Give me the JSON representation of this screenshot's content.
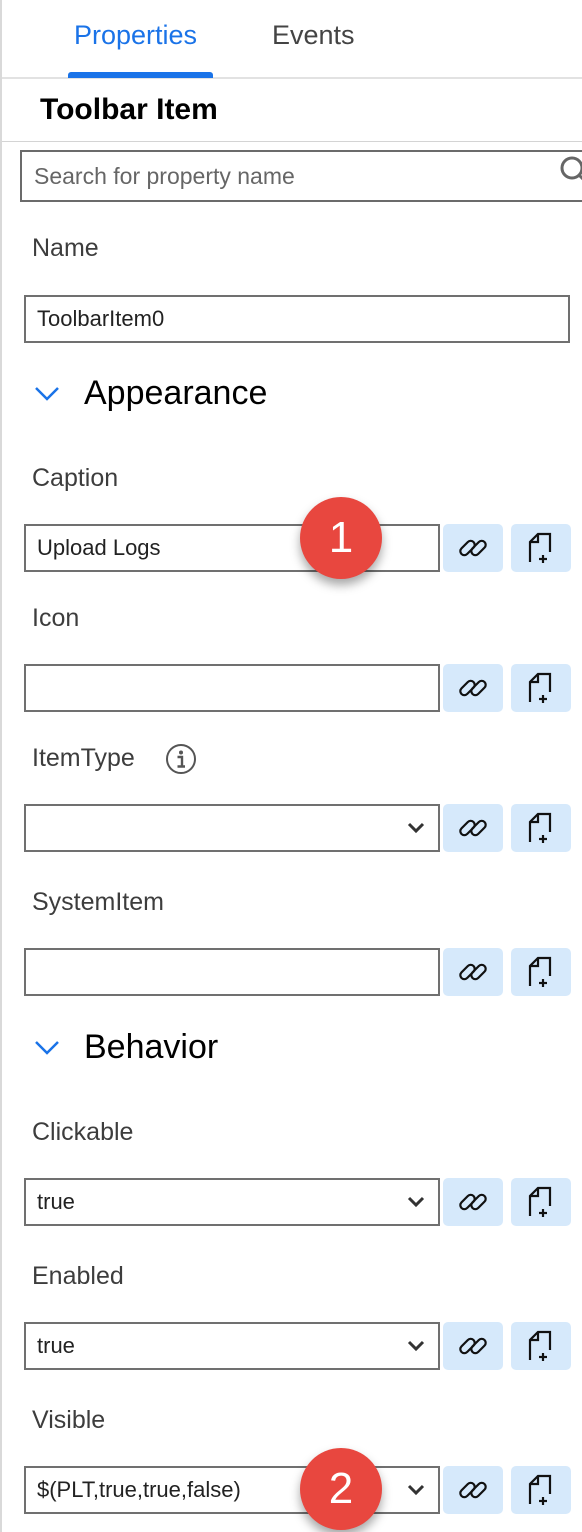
{
  "tabs": [
    {
      "label": "Properties",
      "active": true
    },
    {
      "label": "Events",
      "active": false
    }
  ],
  "panel_title": "Toolbar Item",
  "search": {
    "placeholder": "Search for property name",
    "icon": "search-icon"
  },
  "name_field": {
    "label": "Name",
    "value": "ToolbarItem0"
  },
  "groups": {
    "appearance": {
      "label": "Appearance",
      "icon": "chevron-down-icon"
    },
    "behavior": {
      "label": "Behavior",
      "icon": "chevron-down-icon"
    }
  },
  "properties": {
    "caption": {
      "label": "Caption",
      "value": "Upload Logs"
    },
    "icon": {
      "label": "Icon",
      "value": ""
    },
    "itemtype": {
      "label": "ItemType",
      "value": "",
      "info_icon": "info-icon"
    },
    "systemitem": {
      "label": "SystemItem",
      "value": ""
    },
    "clickable": {
      "label": "Clickable",
      "value": "true"
    },
    "enabled": {
      "label": "Enabled",
      "value": "true"
    },
    "visible": {
      "label": "Visible",
      "value": "$(PLT,true,true,false)"
    }
  },
  "badges": {
    "one": "1",
    "two": "2"
  },
  "colors": {
    "accent": "#1a73e8",
    "button_bg": "#d6e9fb",
    "badge": "#e8473f"
  }
}
